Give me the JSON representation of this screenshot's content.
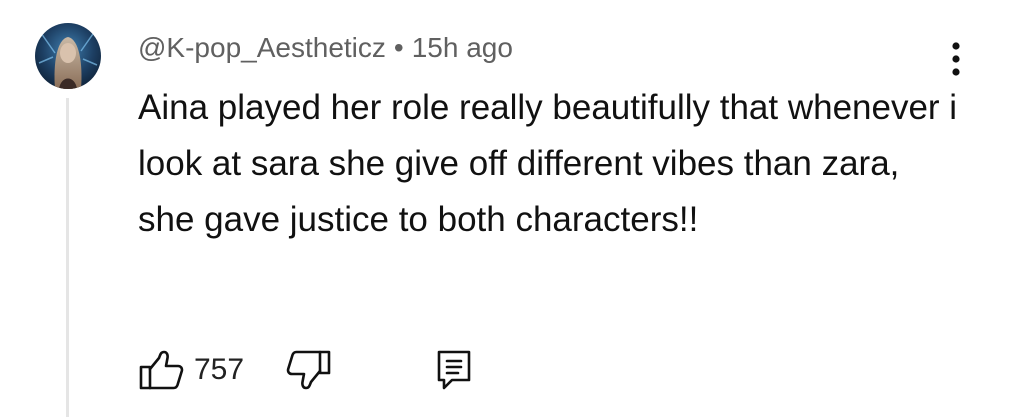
{
  "comment": {
    "author": "@K-pop_Aestheticz",
    "separator": "•",
    "timestamp": "15h ago",
    "text": "Aina played her role really beautifully that whenever i look at sara she give off different vibes than zara, she gave justice to both characters!!",
    "like_count": "757"
  },
  "icons": {
    "more": "more-vert-icon",
    "like": "thumbs-up-icon",
    "dislike": "thumbs-down-icon",
    "reply": "comment-reply-icon"
  },
  "colors": {
    "text_primary": "#111111",
    "text_secondary": "#606060",
    "thread_line": "#e5e5e5"
  }
}
